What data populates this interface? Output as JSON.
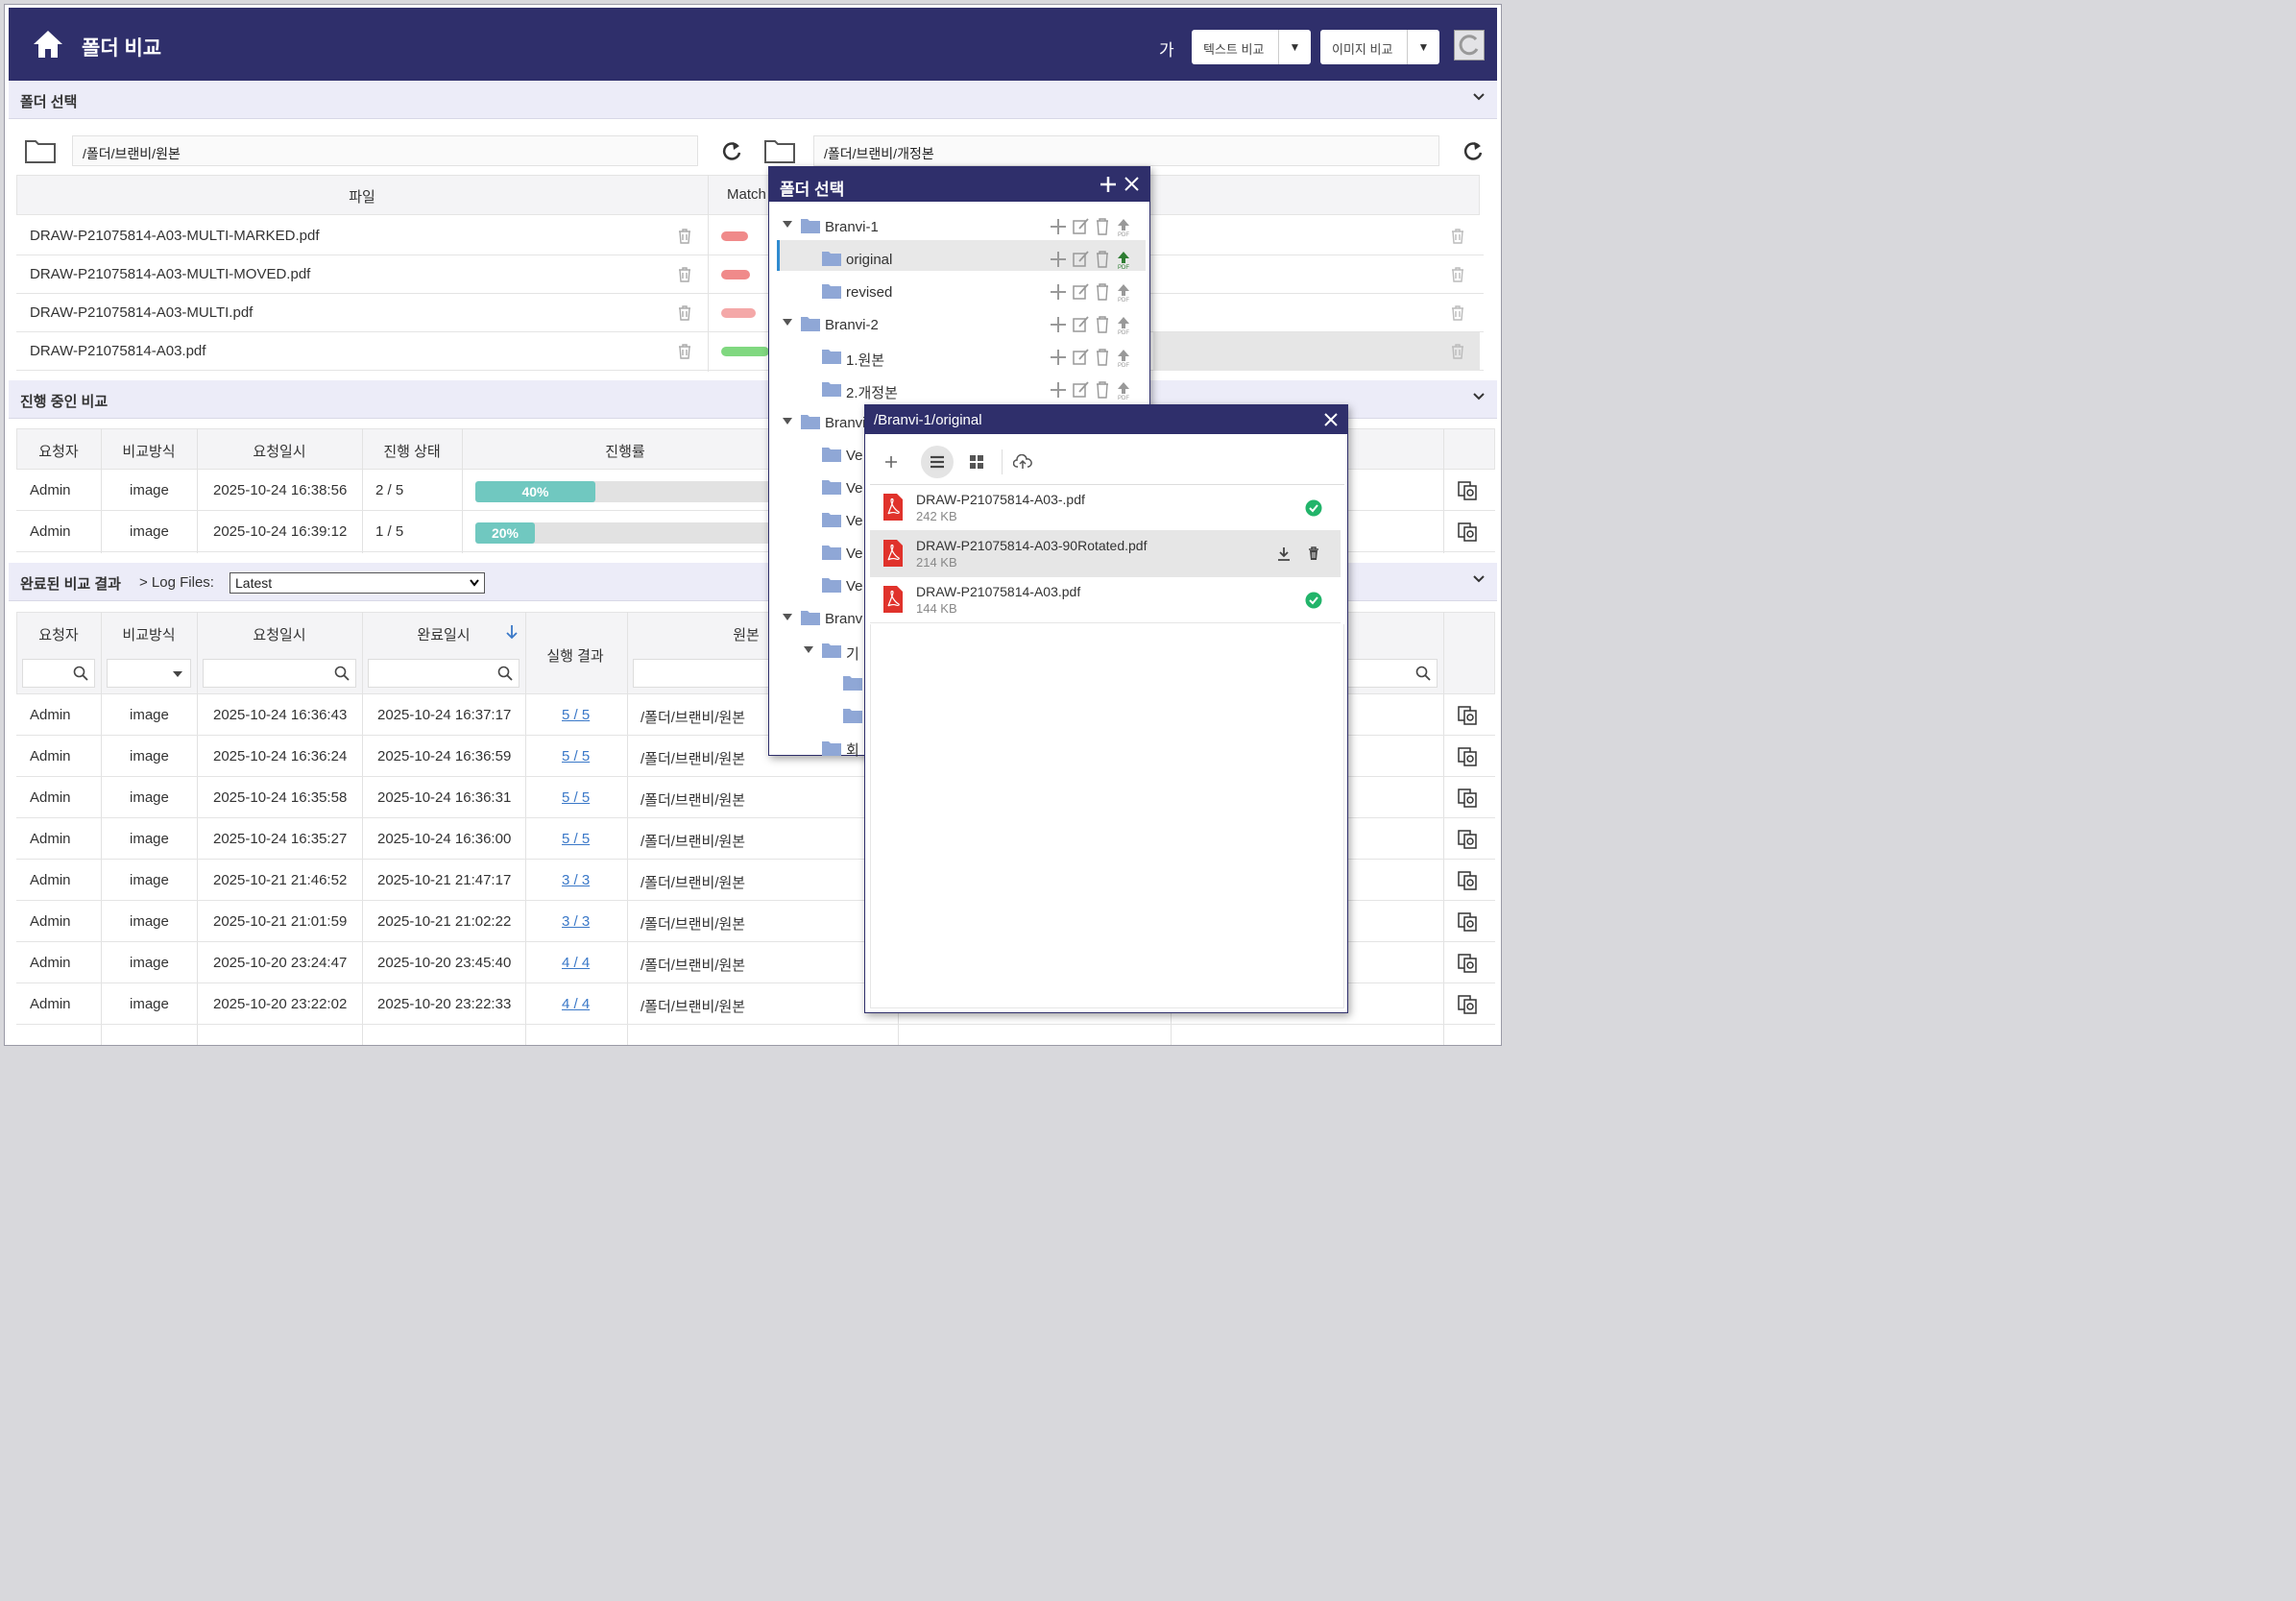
{
  "header": {
    "title": "폴더 비교",
    "font_label": "가",
    "text_compare": "텍스트 비교",
    "image_compare": "이미지 비교"
  },
  "folder_select": {
    "section_title": "폴더 선택",
    "left_path": "/폴더/브랜비/원본",
    "right_path": "/폴더/브랜비/개정본",
    "file_col": "파일",
    "match_col": "Match",
    "files": [
      "DRAW-P21075814-A03-MULTI-MARKED.pdf",
      "DRAW-P21075814-A03-MULTI-MOVED.pdf",
      "DRAW-P21075814-A03-MULTI.pdf",
      "DRAW-P21075814-A03.pdf"
    ],
    "match_colors": [
      "#f08a8a",
      "#f08a8a",
      "#f4a8a8",
      "#80d880"
    ]
  },
  "in_progress": {
    "section_title": "진행 중인 비교",
    "columns": [
      "요청자",
      "비교방식",
      "요청일시",
      "진행 상태",
      "진행률"
    ],
    "rows": [
      {
        "user": "Admin",
        "method": "image",
        "requested": "2025-10-24 16:38:56",
        "status": "2 / 5",
        "progress": 40,
        "progress_label": "40%"
      },
      {
        "user": "Admin",
        "method": "image",
        "requested": "2025-10-24 16:39:12",
        "status": "1 / 5",
        "progress": 20,
        "progress_label": "20%"
      }
    ]
  },
  "completed": {
    "section_title": "완료된 비교 결과",
    "log_label": "> Log Files:",
    "log_value": "Latest",
    "columns": [
      "요청자",
      "비교방식",
      "요청일시",
      "완료일시",
      "실행 결과",
      "원본"
    ],
    "rows": [
      {
        "user": "Admin",
        "method": "image",
        "requested": "2025-10-24 16:36:43",
        "completed": "2025-10-24 16:37:17",
        "result": "5 / 5",
        "source": "/폴더/브랜비/원본"
      },
      {
        "user": "Admin",
        "method": "image",
        "requested": "2025-10-24 16:36:24",
        "completed": "2025-10-24 16:36:59",
        "result": "5 / 5",
        "source": "/폴더/브랜비/원본"
      },
      {
        "user": "Admin",
        "method": "image",
        "requested": "2025-10-24 16:35:58",
        "completed": "2025-10-24 16:36:31",
        "result": "5 / 5",
        "source": "/폴더/브랜비/원본"
      },
      {
        "user": "Admin",
        "method": "image",
        "requested": "2025-10-24 16:35:27",
        "completed": "2025-10-24 16:36:00",
        "result": "5 / 5",
        "source": "/폴더/브랜비/원본"
      },
      {
        "user": "Admin",
        "method": "image",
        "requested": "2025-10-21 21:46:52",
        "completed": "2025-10-21 21:47:17",
        "result": "3 / 3",
        "source": "/폴더/브랜비/원본"
      },
      {
        "user": "Admin",
        "method": "image",
        "requested": "2025-10-21 21:01:59",
        "completed": "2025-10-21 21:02:22",
        "result": "3 / 3",
        "source": "/폴더/브랜비/원본"
      },
      {
        "user": "Admin",
        "method": "image",
        "requested": "2025-10-20 23:24:47",
        "completed": "2025-10-20 23:45:40",
        "result": "4 / 4",
        "source": "/폴더/브랜비/원본"
      },
      {
        "user": "Admin",
        "method": "image",
        "requested": "2025-10-20 23:22:02",
        "completed": "2025-10-20 23:22:33",
        "result": "4 / 4",
        "source": "/폴더/브랜비/원본"
      }
    ]
  },
  "folder_dialog": {
    "title": "폴더 선택",
    "tree": [
      "Branvi-1",
      "original",
      "revised",
      "Branvi-2",
      "1.원본",
      "2.개정본",
      "Branvi",
      "Ve",
      "Ve",
      "Ve",
      "Ve",
      "Ve",
      "Branv",
      "기",
      "회"
    ]
  },
  "file_dialog": {
    "title": "/Branvi-1/original",
    "files": [
      {
        "name": "DRAW-P21075814-A03-.pdf",
        "size": "242 KB"
      },
      {
        "name": "DRAW-P21075814-A03-90Rotated.pdf",
        "size": "214 KB"
      },
      {
        "name": "DRAW-P21075814-A03.pdf",
        "size": "144 KB"
      }
    ]
  },
  "colors": {
    "navy": "#2f2f6b",
    "section": "#ececf8",
    "progress": "#70c8c0",
    "link": "#3a78c8",
    "check": "#22b46a",
    "pdf": "#e0322b",
    "folder": "#8fa7d6"
  }
}
